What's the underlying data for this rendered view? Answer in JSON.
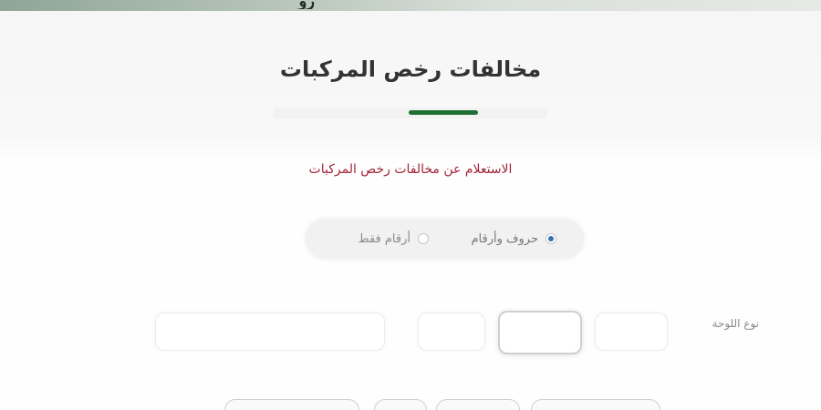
{
  "header": {
    "logo_text": "رو"
  },
  "page": {
    "title": "مخالفات رخص المركبات",
    "subtitle": "الاستعلام عن مخالفات رخص المركبات"
  },
  "search_type": {
    "options": [
      {
        "label": "حروف وأرقام",
        "selected": true
      },
      {
        "label": "أرقام فقط",
        "selected": false
      }
    ]
  },
  "form": {
    "plate_label": "نوع اللوحة"
  },
  "colors": {
    "accent_green": "#1f6f33",
    "subtitle_red": "#a3243a",
    "radio_blue": "#3a6fb0"
  }
}
